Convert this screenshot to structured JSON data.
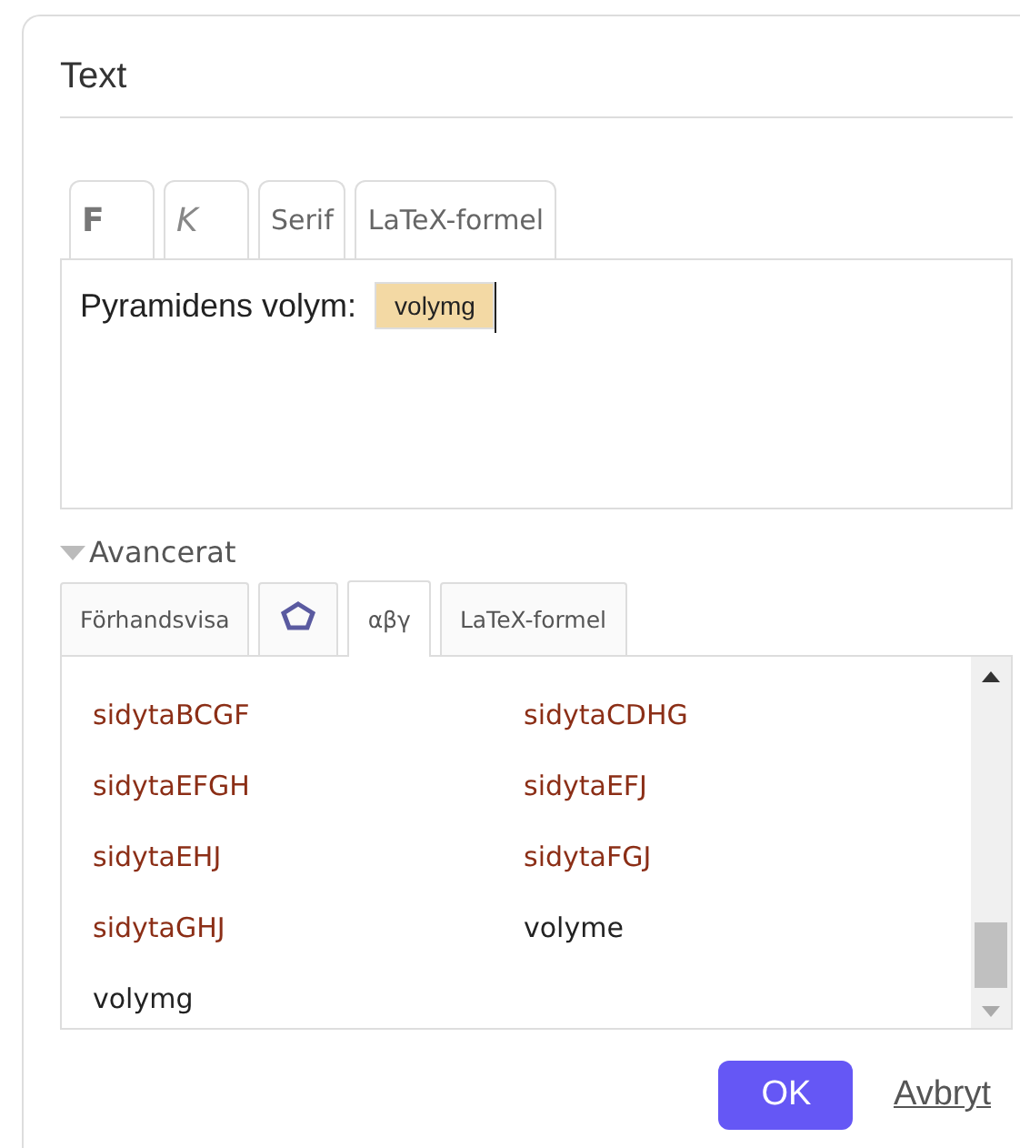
{
  "dialog": {
    "title": "Text"
  },
  "toolbar": [
    {
      "label": "F",
      "kind": "bold"
    },
    {
      "label": "K",
      "kind": "italic"
    },
    {
      "label": "Serif",
      "kind": "plain"
    },
    {
      "label": "LaTeX-formel",
      "kind": "plain"
    }
  ],
  "editor": {
    "text": "Pyramidens volym:",
    "object": "volymg"
  },
  "advanced": {
    "label": "Avancerat",
    "expanded": true
  },
  "tabs": [
    {
      "label": "Förhandsvisa",
      "kind": "text",
      "selected": false
    },
    {
      "kind": "icon",
      "selected": false
    },
    {
      "label": "αβγ",
      "kind": "text",
      "selected": true
    },
    {
      "label": "LaTeX-formel",
      "kind": "text",
      "selected": false
    }
  ],
  "objects": [
    {
      "name": "sidytaBCGF",
      "color": "#8b2e16"
    },
    {
      "name": "sidytaCDHG",
      "color": "#8b2e16"
    },
    {
      "name": "sidytaEFGH",
      "color": "#8b2e16"
    },
    {
      "name": "sidytaEFJ",
      "color": "#8b2e16"
    },
    {
      "name": "sidytaEHJ",
      "color": "#8b2e16"
    },
    {
      "name": "sidytaFGJ",
      "color": "#8b2e16"
    },
    {
      "name": "sidytaGHJ",
      "color": "#8b2e16"
    },
    {
      "name": "volyme",
      "color": "#222222"
    },
    {
      "name": "volymg",
      "color": "#222222"
    }
  ],
  "buttons": {
    "ok": "OK",
    "cancel": "Avbryt"
  }
}
